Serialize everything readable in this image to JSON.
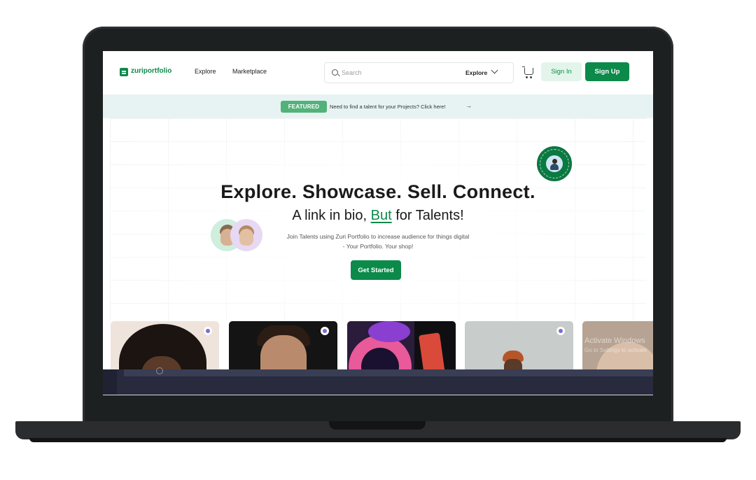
{
  "header": {
    "logo": "zuriportfolio",
    "nav": [
      "Explore",
      "Marketplace"
    ],
    "search_placeholder": "Search",
    "explore_dropdown": "Explore",
    "sign_in": "Sign In",
    "sign_up": "Sign Up"
  },
  "banner": {
    "badge": "FEATURED",
    "text": "Need to find a talent for your Projects? Click here!",
    "arrow": "→"
  },
  "hero": {
    "title": "Explore. Showcase. Sell. Connect.",
    "subtitle_pre": "A link in bio, ",
    "subtitle_accent": "But",
    "subtitle_post": " for Talents!",
    "desc_line1": "Join Talents using Zuri Portfolio to increase audience for things digital",
    "desc_line2": "- Your Portfolio. Your shop!",
    "cta": "Get Started"
  },
  "watermark": {
    "title": "Activate Windows",
    "subtitle": "Go to Settings to activate"
  },
  "colors": {
    "brand": "#0b8a4a",
    "brand_light": "#e3f5ea",
    "banner_bg": "#e6f3f2",
    "featured_badge": "#52b27a",
    "laptop": "#1d2021"
  },
  "icons": [
    "search-icon",
    "chevron-down-icon",
    "cart-icon",
    "verified-badge-icon"
  ]
}
